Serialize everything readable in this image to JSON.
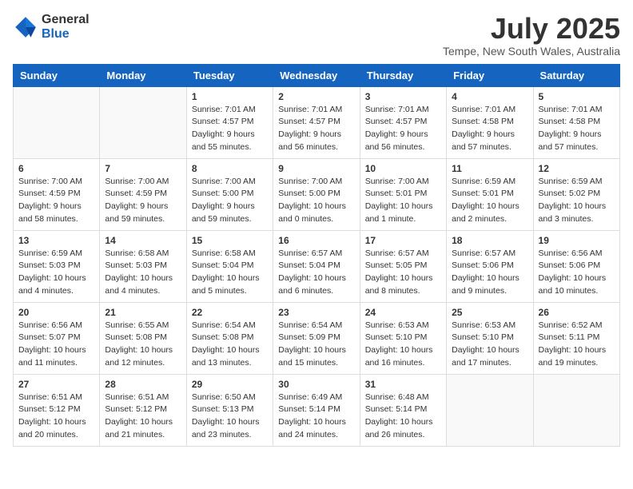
{
  "header": {
    "logo_general": "General",
    "logo_blue": "Blue",
    "month_title": "July 2025",
    "location": "Tempe, New South Wales, Australia"
  },
  "calendar": {
    "days_of_week": [
      "Sunday",
      "Monday",
      "Tuesday",
      "Wednesday",
      "Thursday",
      "Friday",
      "Saturday"
    ],
    "weeks": [
      [
        {
          "day": "",
          "info": ""
        },
        {
          "day": "",
          "info": ""
        },
        {
          "day": "1",
          "info": "Sunrise: 7:01 AM\nSunset: 4:57 PM\nDaylight: 9 hours\nand 55 minutes."
        },
        {
          "day": "2",
          "info": "Sunrise: 7:01 AM\nSunset: 4:57 PM\nDaylight: 9 hours\nand 56 minutes."
        },
        {
          "day": "3",
          "info": "Sunrise: 7:01 AM\nSunset: 4:57 PM\nDaylight: 9 hours\nand 56 minutes."
        },
        {
          "day": "4",
          "info": "Sunrise: 7:01 AM\nSunset: 4:58 PM\nDaylight: 9 hours\nand 57 minutes."
        },
        {
          "day": "5",
          "info": "Sunrise: 7:01 AM\nSunset: 4:58 PM\nDaylight: 9 hours\nand 57 minutes."
        }
      ],
      [
        {
          "day": "6",
          "info": "Sunrise: 7:00 AM\nSunset: 4:59 PM\nDaylight: 9 hours\nand 58 minutes."
        },
        {
          "day": "7",
          "info": "Sunrise: 7:00 AM\nSunset: 4:59 PM\nDaylight: 9 hours\nand 59 minutes."
        },
        {
          "day": "8",
          "info": "Sunrise: 7:00 AM\nSunset: 5:00 PM\nDaylight: 9 hours\nand 59 minutes."
        },
        {
          "day": "9",
          "info": "Sunrise: 7:00 AM\nSunset: 5:00 PM\nDaylight: 10 hours\nand 0 minutes."
        },
        {
          "day": "10",
          "info": "Sunrise: 7:00 AM\nSunset: 5:01 PM\nDaylight: 10 hours\nand 1 minute."
        },
        {
          "day": "11",
          "info": "Sunrise: 6:59 AM\nSunset: 5:01 PM\nDaylight: 10 hours\nand 2 minutes."
        },
        {
          "day": "12",
          "info": "Sunrise: 6:59 AM\nSunset: 5:02 PM\nDaylight: 10 hours\nand 3 minutes."
        }
      ],
      [
        {
          "day": "13",
          "info": "Sunrise: 6:59 AM\nSunset: 5:03 PM\nDaylight: 10 hours\nand 4 minutes."
        },
        {
          "day": "14",
          "info": "Sunrise: 6:58 AM\nSunset: 5:03 PM\nDaylight: 10 hours\nand 4 minutes."
        },
        {
          "day": "15",
          "info": "Sunrise: 6:58 AM\nSunset: 5:04 PM\nDaylight: 10 hours\nand 5 minutes."
        },
        {
          "day": "16",
          "info": "Sunrise: 6:57 AM\nSunset: 5:04 PM\nDaylight: 10 hours\nand 6 minutes."
        },
        {
          "day": "17",
          "info": "Sunrise: 6:57 AM\nSunset: 5:05 PM\nDaylight: 10 hours\nand 8 minutes."
        },
        {
          "day": "18",
          "info": "Sunrise: 6:57 AM\nSunset: 5:06 PM\nDaylight: 10 hours\nand 9 minutes."
        },
        {
          "day": "19",
          "info": "Sunrise: 6:56 AM\nSunset: 5:06 PM\nDaylight: 10 hours\nand 10 minutes."
        }
      ],
      [
        {
          "day": "20",
          "info": "Sunrise: 6:56 AM\nSunset: 5:07 PM\nDaylight: 10 hours\nand 11 minutes."
        },
        {
          "day": "21",
          "info": "Sunrise: 6:55 AM\nSunset: 5:08 PM\nDaylight: 10 hours\nand 12 minutes."
        },
        {
          "day": "22",
          "info": "Sunrise: 6:54 AM\nSunset: 5:08 PM\nDaylight: 10 hours\nand 13 minutes."
        },
        {
          "day": "23",
          "info": "Sunrise: 6:54 AM\nSunset: 5:09 PM\nDaylight: 10 hours\nand 15 minutes."
        },
        {
          "day": "24",
          "info": "Sunrise: 6:53 AM\nSunset: 5:10 PM\nDaylight: 10 hours\nand 16 minutes."
        },
        {
          "day": "25",
          "info": "Sunrise: 6:53 AM\nSunset: 5:10 PM\nDaylight: 10 hours\nand 17 minutes."
        },
        {
          "day": "26",
          "info": "Sunrise: 6:52 AM\nSunset: 5:11 PM\nDaylight: 10 hours\nand 19 minutes."
        }
      ],
      [
        {
          "day": "27",
          "info": "Sunrise: 6:51 AM\nSunset: 5:12 PM\nDaylight: 10 hours\nand 20 minutes."
        },
        {
          "day": "28",
          "info": "Sunrise: 6:51 AM\nSunset: 5:12 PM\nDaylight: 10 hours\nand 21 minutes."
        },
        {
          "day": "29",
          "info": "Sunrise: 6:50 AM\nSunset: 5:13 PM\nDaylight: 10 hours\nand 23 minutes."
        },
        {
          "day": "30",
          "info": "Sunrise: 6:49 AM\nSunset: 5:14 PM\nDaylight: 10 hours\nand 24 minutes."
        },
        {
          "day": "31",
          "info": "Sunrise: 6:48 AM\nSunset: 5:14 PM\nDaylight: 10 hours\nand 26 minutes."
        },
        {
          "day": "",
          "info": ""
        },
        {
          "day": "",
          "info": ""
        }
      ]
    ]
  }
}
